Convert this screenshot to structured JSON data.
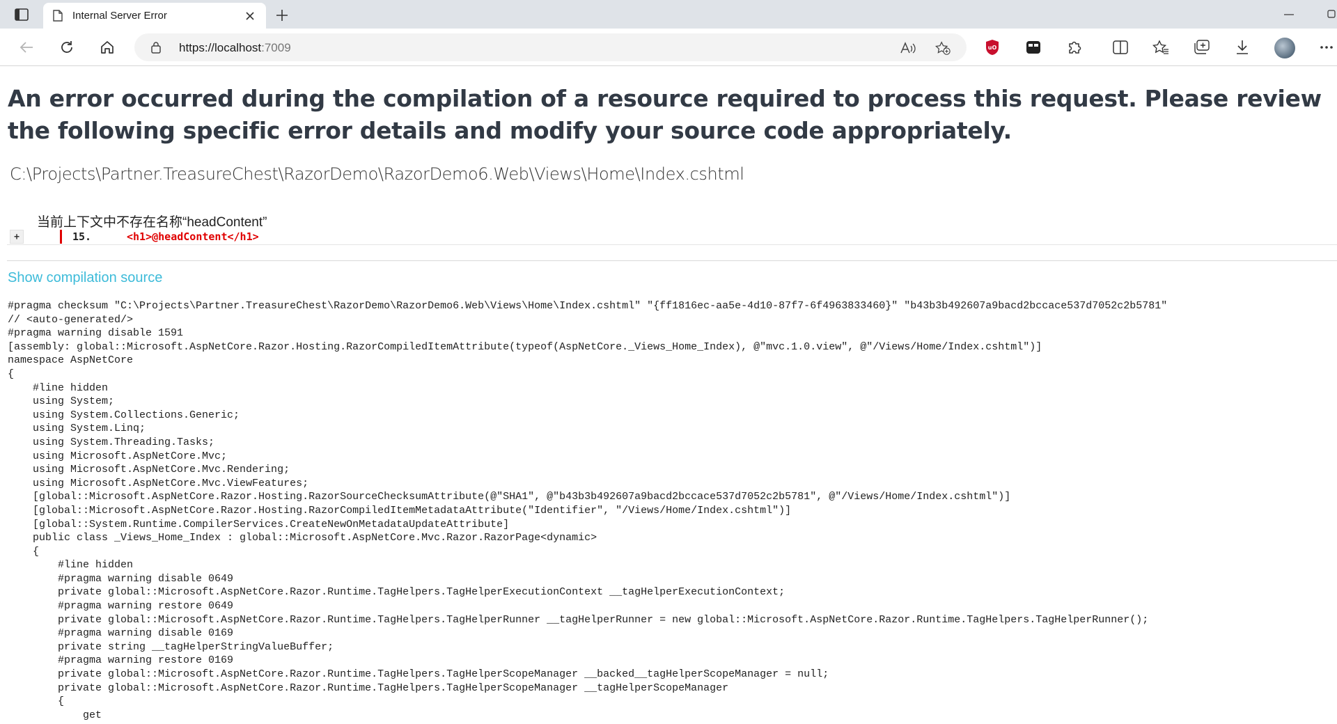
{
  "browser": {
    "tab_title": "Internal Server Error",
    "url_host": "https://localhost",
    "url_port": ":7009"
  },
  "page": {
    "heading": "An error occurred during the compilation of a resource required to process this request. Please review the following specific error details and modify your source code appropriately.",
    "file_path": "C:\\Projects\\Partner.TreasureChest\\RazorDemo\\RazorDemo6.Web\\Views\\Home\\Index.cshtml",
    "error_message": "当前上下文中不存在名称“headContent”",
    "expand_label": "+",
    "error_line_number": "15.",
    "error_line_code": "<h1>@headContent</h1>",
    "show_source_label": "Show compilation source",
    "source_lines": [
      "#pragma checksum \"C:\\Projects\\Partner.TreasureChest\\RazorDemo\\RazorDemo6.Web\\Views\\Home\\Index.cshtml\" \"{ff1816ec-aa5e-4d10-87f7-6f4963833460}\" \"b43b3b492607a9bacd2bccace537d7052c2b5781\"",
      "// <auto-generated/>",
      "#pragma warning disable 1591",
      "[assembly: global::Microsoft.AspNetCore.Razor.Hosting.RazorCompiledItemAttribute(typeof(AspNetCore._Views_Home_Index), @\"mvc.1.0.view\", @\"/Views/Home/Index.cshtml\")]",
      "namespace AspNetCore",
      "{",
      "    #line hidden",
      "    using System;",
      "    using System.Collections.Generic;",
      "    using System.Linq;",
      "    using System.Threading.Tasks;",
      "    using Microsoft.AspNetCore.Mvc;",
      "    using Microsoft.AspNetCore.Mvc.Rendering;",
      "    using Microsoft.AspNetCore.Mvc.ViewFeatures;",
      "    [global::Microsoft.AspNetCore.Razor.Hosting.RazorSourceChecksumAttribute(@\"SHA1\", @\"b43b3b492607a9bacd2bccace537d7052c2b5781\", @\"/Views/Home/Index.cshtml\")]",
      "    [global::Microsoft.AspNetCore.Razor.Hosting.RazorCompiledItemMetadataAttribute(\"Identifier\", \"/Views/Home/Index.cshtml\")]",
      "    [global::System.Runtime.CompilerServices.CreateNewOnMetadataUpdateAttribute]",
      "    public class _Views_Home_Index : global::Microsoft.AspNetCore.Mvc.Razor.RazorPage<dynamic>",
      "    {",
      "        #line hidden",
      "        #pragma warning disable 0649",
      "        private global::Microsoft.AspNetCore.Razor.Runtime.TagHelpers.TagHelperExecutionContext __tagHelperExecutionContext;",
      "        #pragma warning restore 0649",
      "        private global::Microsoft.AspNetCore.Razor.Runtime.TagHelpers.TagHelperRunner __tagHelperRunner = new global::Microsoft.AspNetCore.Razor.Runtime.TagHelpers.TagHelperRunner();",
      "        #pragma warning disable 0169",
      "        private string __tagHelperStringValueBuffer;",
      "        #pragma warning restore 0169",
      "        private global::Microsoft.AspNetCore.Razor.Runtime.TagHelpers.TagHelperScopeManager __backed__tagHelperScopeManager = null;",
      "        private global::Microsoft.AspNetCore.Razor.Runtime.TagHelpers.TagHelperScopeManager __tagHelperScopeManager",
      "        {",
      "            get"
    ]
  },
  "icons": {
    "tab_actions": "tab-actions-icon",
    "favicon": "page-icon",
    "close": "close-icon",
    "new_tab": "plus-icon",
    "back": "back-arrow-icon",
    "refresh": "refresh-icon",
    "home": "home-icon",
    "lock": "lock-icon",
    "read_aloud": "read-aloud-icon",
    "add_favorite": "add-favorite-icon",
    "ublock": "ublock-origin-icon",
    "extension_app": "app-icon",
    "extensions": "puzzle-icon",
    "split_screen": "split-screen-icon",
    "favorites": "favorites-icon",
    "collections": "collections-icon",
    "downloads": "download-icon",
    "more": "more-icon"
  },
  "colors": {
    "heading": "#323a45",
    "error_red": "#e00000",
    "link": "#3dbbd9",
    "ublock": "#c8102e"
  }
}
